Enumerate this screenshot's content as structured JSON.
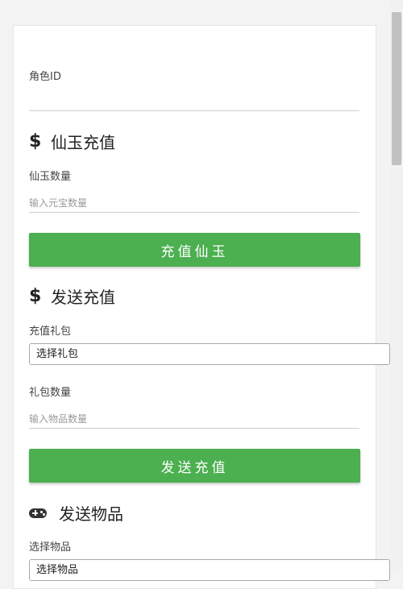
{
  "role": {
    "label": "角色ID",
    "value": ""
  },
  "xianyu_recharge": {
    "icon": "dollar-icon",
    "title": "仙玉充值",
    "amount_label": "仙玉数量",
    "amount_placeholder": "输入元宝数量",
    "button_label": "充值仙玉"
  },
  "send_recharge": {
    "icon": "dollar-icon",
    "title": "发送充值",
    "package_label": "充值礼包",
    "package_selected": "选择礼包",
    "quantity_label": "礼包数量",
    "quantity_placeholder": "输入物品数量",
    "button_label": "发送充值"
  },
  "send_items": {
    "icon": "gamepad-icon",
    "title": "发送物品",
    "item_label": "选择物品",
    "item_selected": "选择物品"
  },
  "colors": {
    "button_green": "#4caf50",
    "background": "#f3f3f3",
    "card": "#ffffff"
  }
}
